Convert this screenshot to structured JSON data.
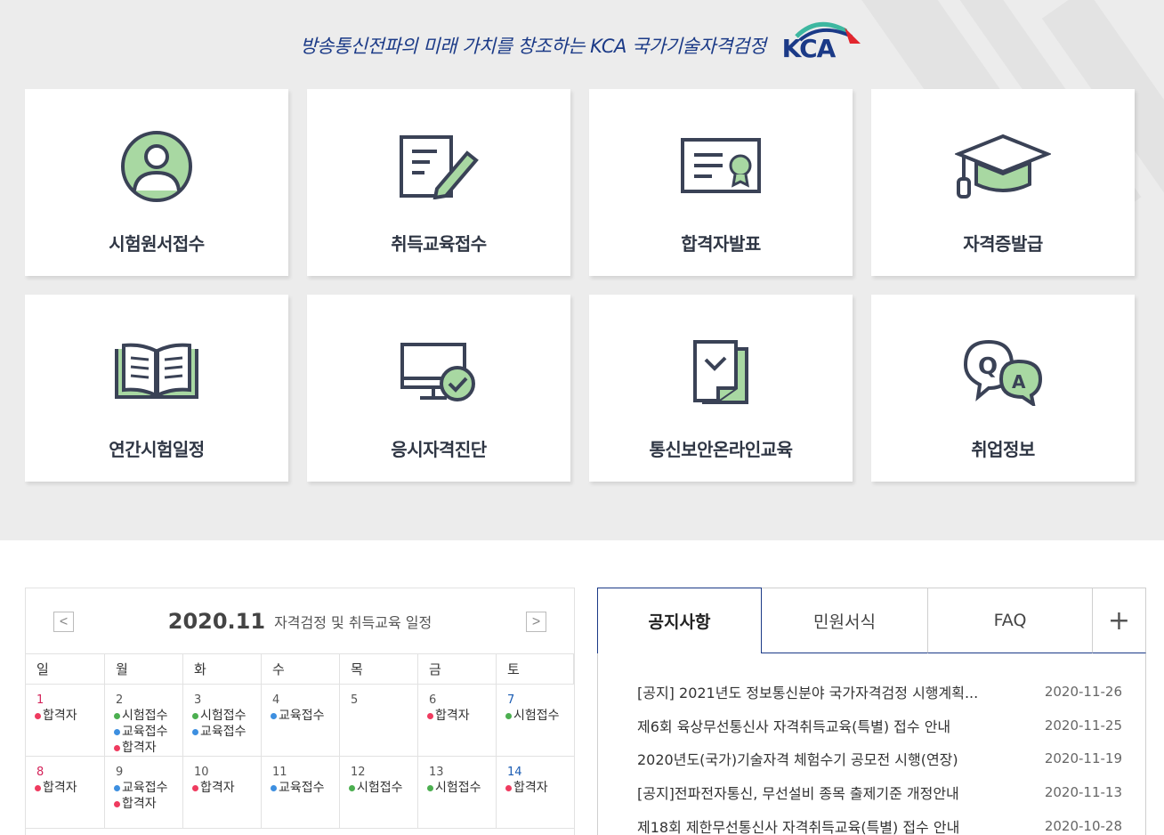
{
  "header": {
    "slogan": "방송통신전파의 미래 가치를 창조하는 KCA 국가기술자격검정",
    "logo_text": "KCA"
  },
  "menu": [
    {
      "label": "시험원서접수",
      "icon": "user-profile-icon"
    },
    {
      "label": "취득교육접수",
      "icon": "document-pen-icon"
    },
    {
      "label": "합격자발표",
      "icon": "certificate-icon"
    },
    {
      "label": "자격증발급",
      "icon": "graduation-cap-icon"
    },
    {
      "label": "연간시험일정",
      "icon": "open-book-icon"
    },
    {
      "label": "응시자격진단",
      "icon": "monitor-check-icon"
    },
    {
      "label": "통신보안온라인교육",
      "icon": "document-check-icon"
    },
    {
      "label": "취업정보",
      "icon": "qa-bubble-icon"
    }
  ],
  "calendar": {
    "month": "2020.11",
    "subtitle": "자격검정 및 취득교육 일정",
    "prev": "<",
    "next": ">",
    "weekdays": [
      "일",
      "월",
      "화",
      "수",
      "목",
      "금",
      "토"
    ],
    "event_colors": {
      "합격자": "#ef3b5f",
      "시험접수": "#4caf50",
      "교육접수": "#3d8fe0"
    },
    "weeks": [
      [
        {
          "date": "1",
          "events": [
            "합격자"
          ]
        },
        {
          "date": "2",
          "events": [
            "시험접수",
            "교육접수",
            "합격자"
          ]
        },
        {
          "date": "3",
          "events": [
            "시험접수",
            "교육접수"
          ]
        },
        {
          "date": "4",
          "events": [
            "교육접수"
          ]
        },
        {
          "date": "5",
          "events": []
        },
        {
          "date": "6",
          "events": [
            "합격자"
          ]
        },
        {
          "date": "7",
          "events": [
            "시험접수"
          ]
        }
      ],
      [
        {
          "date": "8",
          "events": [
            "합격자"
          ]
        },
        {
          "date": "9",
          "events": [
            "교육접수",
            "합격자"
          ]
        },
        {
          "date": "10",
          "events": [
            "합격자"
          ]
        },
        {
          "date": "11",
          "events": [
            "교육접수"
          ]
        },
        {
          "date": "12",
          "events": [
            "시험접수"
          ]
        },
        {
          "date": "13",
          "events": [
            "시험접수"
          ]
        },
        {
          "date": "14",
          "events": [
            "합격자"
          ]
        }
      ]
    ]
  },
  "board": {
    "tabs": [
      "공지사항",
      "민원서식",
      "FAQ"
    ],
    "more": "+",
    "notices": [
      {
        "title": "[공지] 2021년도 정보통신분야 국가자격검정 시행계획...",
        "date": "2020-11-26"
      },
      {
        "title": "제6회 육상무선통신사 자격취득교육(특별) 접수 안내",
        "date": "2020-11-25"
      },
      {
        "title": "2020년도(국가)기술자격 체험수기 공모전 시행(연장)",
        "date": "2020-11-19"
      },
      {
        "title": "[공지]전파전자통신, 무선설비 종목 출제기준 개정안내",
        "date": "2020-11-13"
      },
      {
        "title": "제18회 제한무선통신사 자격취득교육(특별) 접수 안내",
        "date": "2020-10-28"
      }
    ]
  }
}
